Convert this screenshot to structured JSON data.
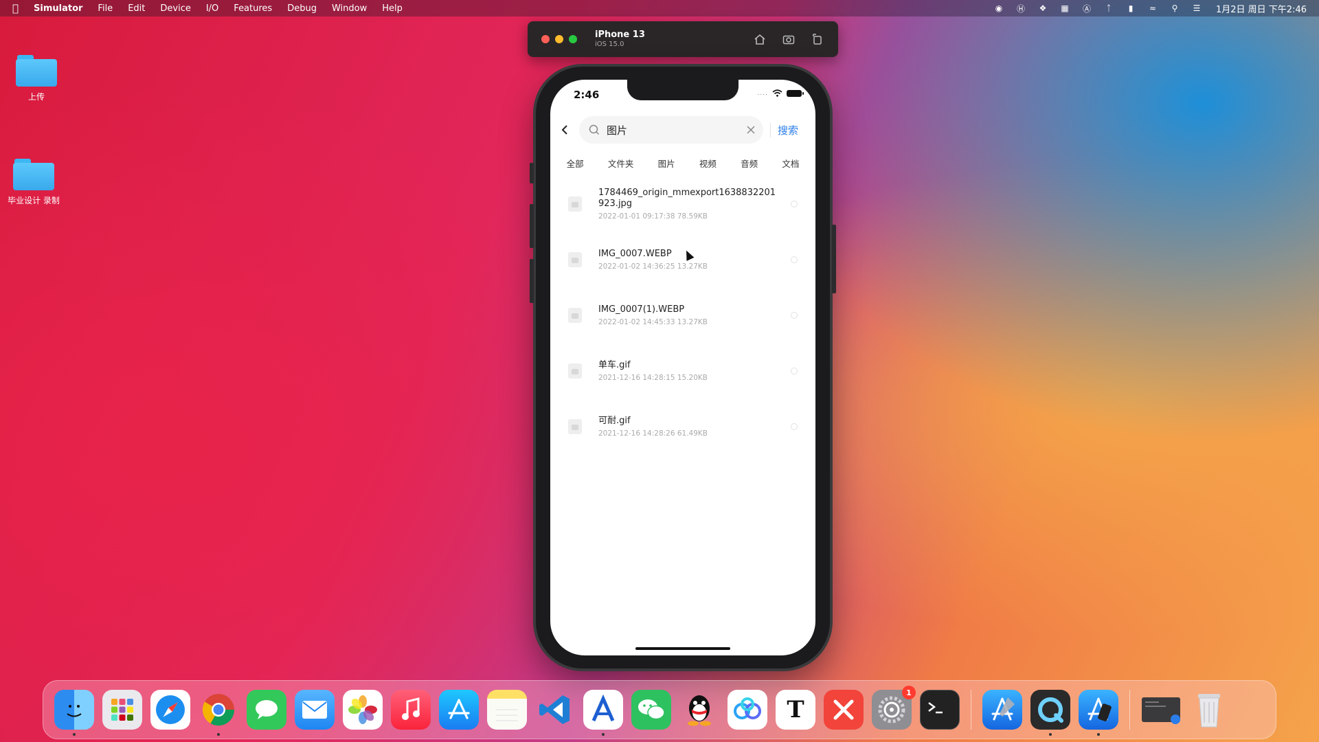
{
  "menubar": {
    "app_name": "Simulator",
    "menus": [
      "File",
      "Edit",
      "Device",
      "I/O",
      "Features",
      "Debug",
      "Window",
      "Help"
    ],
    "clock": "1月2日 周日 下午2:46"
  },
  "desktop": {
    "icons": [
      {
        "label": "上传"
      },
      {
        "label": "毕业设计 录制"
      }
    ]
  },
  "simulator": {
    "device_name": "iPhone 13",
    "os_version": "iOS 15.0"
  },
  "phone": {
    "status_time": "2:46",
    "search": {
      "value": "图片",
      "button_label": "搜索"
    },
    "tabs": [
      "全部",
      "文件夹",
      "图片",
      "视频",
      "音频",
      "文档"
    ],
    "files": [
      {
        "name": "1784469_origin_mmexport1638832201923.jpg",
        "meta": "2022-01-01 09:17:38  78.59KB"
      },
      {
        "name": "IMG_0007.WEBP",
        "meta": "2022-01-02 14:36:25  13.27KB"
      },
      {
        "name": "IMG_0007(1).WEBP",
        "meta": "2022-01-02 14:45:33  13.27KB"
      },
      {
        "name": "单车.gif",
        "meta": "2021-12-16 14:28:15  15.20KB"
      },
      {
        "name": "可耐.gif",
        "meta": "2021-12-16 14:28:26  61.49KB"
      }
    ]
  },
  "dock": {
    "apps": [
      {
        "name": "finder-icon",
        "color": "#2d8cf0"
      },
      {
        "name": "launchpad-icon",
        "color": "#e9e9ee"
      },
      {
        "name": "safari-icon",
        "color": "#1c8ef0"
      },
      {
        "name": "chrome-icon",
        "color": "#ffffff"
      },
      {
        "name": "messages-icon",
        "color": "#33c85a"
      },
      {
        "name": "mail-icon",
        "color": "#2f9af5"
      },
      {
        "name": "photos-icon",
        "color": "#ffffff"
      },
      {
        "name": "music-icon",
        "color": "#fa3b55"
      },
      {
        "name": "app-store-icon",
        "color": "#1a8cf2"
      },
      {
        "name": "notes-icon",
        "color": "#fff2b0"
      },
      {
        "name": "vscode-icon",
        "color": "#1f7fd4"
      },
      {
        "name": "instruments-icon",
        "color": "#ffffff"
      },
      {
        "name": "wechat-icon",
        "color": "#2dc160"
      },
      {
        "name": "qq-icon",
        "color": "#ffffff"
      },
      {
        "name": "baidu-netdisk-icon",
        "color": "#ffffff"
      },
      {
        "name": "typora-icon",
        "color": "#ffffff"
      },
      {
        "name": "xmind-icon",
        "color": "#f2443a"
      },
      {
        "name": "system-preferences-icon",
        "color": "#8e8e93"
      },
      {
        "name": "terminal-icon",
        "color": "#222222"
      },
      {
        "name": "xcode-icon",
        "color": "#1e90f0"
      },
      {
        "name": "quicktime-icon",
        "color": "#2a2a2a"
      },
      {
        "name": "simulator-app-icon",
        "color": "#1d8ef0"
      },
      {
        "name": "recent-window-icon",
        "color": "#3a3a3c"
      },
      {
        "name": "trash-icon",
        "color": "#e6e6e6"
      }
    ],
    "system_prefs_badge": "1"
  }
}
